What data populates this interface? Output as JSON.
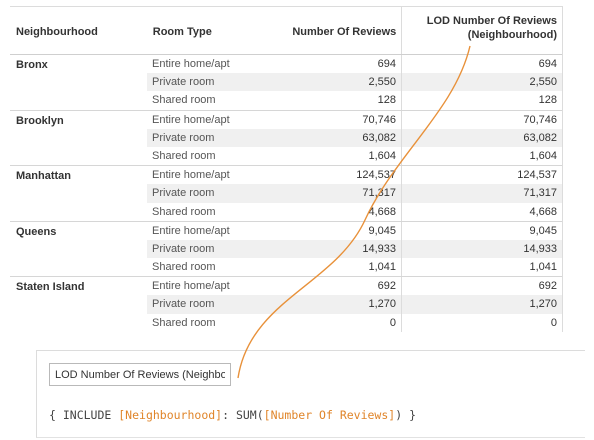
{
  "headers": {
    "neighbourhood": "Neighbourhood",
    "room_type": "Room Type",
    "num_reviews": "Number Of Reviews",
    "lod_line1": "LOD Number Of Reviews",
    "lod_line2": "(Neighbourhood)"
  },
  "groups": [
    {
      "name": "Bronx",
      "rows": [
        {
          "room_type": "Entire home/apt",
          "reviews": "694",
          "lod": "694"
        },
        {
          "room_type": "Private room",
          "reviews": "2,550",
          "lod": "2,550"
        },
        {
          "room_type": "Shared room",
          "reviews": "128",
          "lod": "128"
        }
      ]
    },
    {
      "name": "Brooklyn",
      "rows": [
        {
          "room_type": "Entire home/apt",
          "reviews": "70,746",
          "lod": "70,746"
        },
        {
          "room_type": "Private room",
          "reviews": "63,082",
          "lod": "63,082"
        },
        {
          "room_type": "Shared room",
          "reviews": "1,604",
          "lod": "1,604"
        }
      ]
    },
    {
      "name": "Manhattan",
      "rows": [
        {
          "room_type": "Entire home/apt",
          "reviews": "124,537",
          "lod": "124,537"
        },
        {
          "room_type": "Private room",
          "reviews": "71,317",
          "lod": "71,317"
        },
        {
          "room_type": "Shared room",
          "reviews": "4,668",
          "lod": "4,668"
        }
      ]
    },
    {
      "name": "Queens",
      "rows": [
        {
          "room_type": "Entire home/apt",
          "reviews": "9,045",
          "lod": "9,045"
        },
        {
          "room_type": "Private room",
          "reviews": "14,933",
          "lod": "14,933"
        },
        {
          "room_type": "Shared room",
          "reviews": "1,041",
          "lod": "1,041"
        }
      ]
    },
    {
      "name": "Staten Island",
      "rows": [
        {
          "room_type": "Entire home/apt",
          "reviews": "692",
          "lod": "692"
        },
        {
          "room_type": "Private room",
          "reviews": "1,270",
          "lod": "1,270"
        },
        {
          "room_type": "Shared room",
          "reviews": "0",
          "lod": "0"
        }
      ]
    }
  ],
  "editor": {
    "calc_name_value": "LOD Number Of Reviews (Neighbou",
    "formula": {
      "open": "{ INCLUDE ",
      "dim_field": "[Neighbourhood]",
      "mid": ": SUM(",
      "measure_field": "[Number Of Reviews]",
      "close": ") }"
    }
  },
  "colors": {
    "field_token": "#e0852a",
    "connector": "#e8913a",
    "row_shade": "#f0f0f0"
  }
}
